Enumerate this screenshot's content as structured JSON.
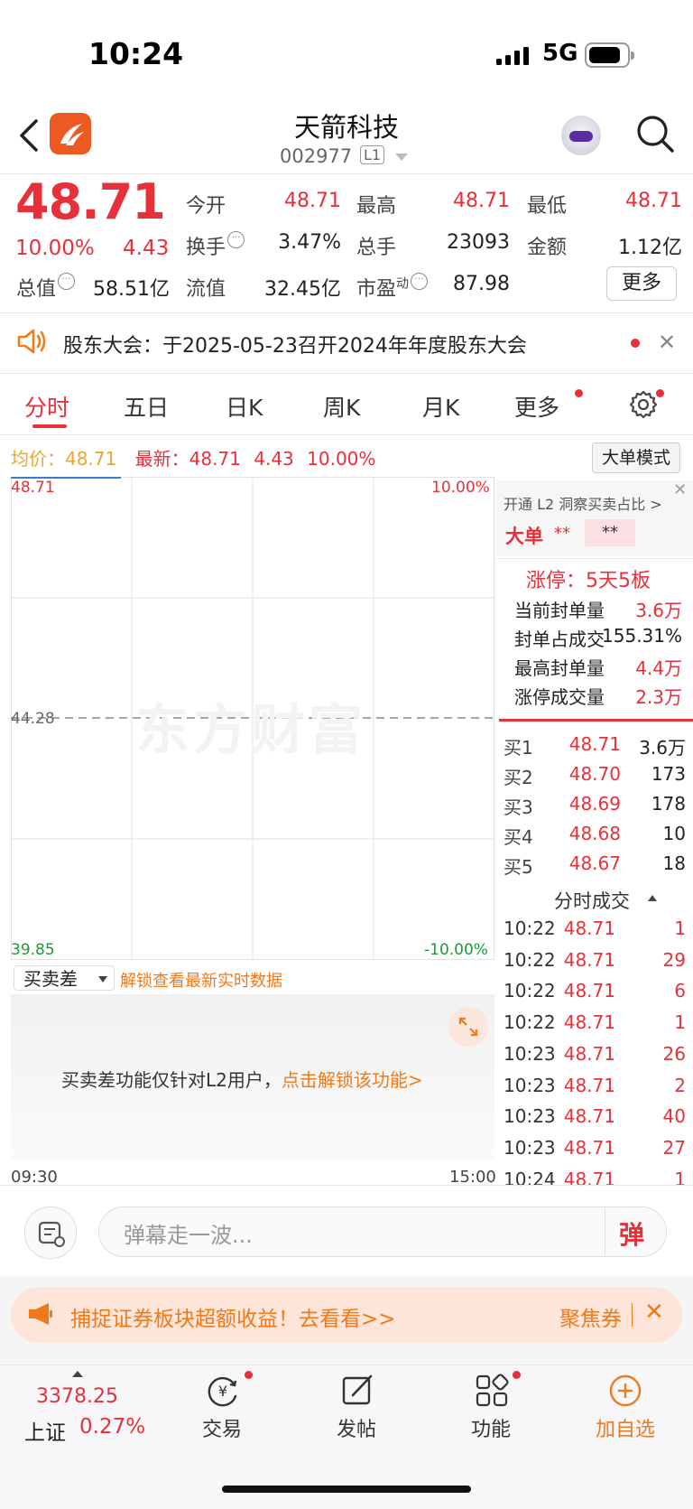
{
  "status_bar": {
    "time": "10:24",
    "network": "5G"
  },
  "header": {
    "title": "天箭科技",
    "code": "002977",
    "level": "L1"
  },
  "quote": {
    "price": "48.71",
    "change_pct": "10.00%",
    "change": "4.43",
    "open_label": "今开",
    "open": "48.71",
    "high_label": "最高",
    "high": "48.71",
    "low_label": "最低",
    "low": "48.71",
    "turnover_label": "换手",
    "turnover": "3.47%",
    "volume_label": "总手",
    "volume": "23093",
    "amount_label": "金额",
    "amount": "1.12亿",
    "mcap_label": "总值",
    "mcap": "58.51亿",
    "float_label": "流值",
    "float": "32.45亿",
    "pe_label": "市盈",
    "pe_sup": "动",
    "pe": "87.98",
    "more": "更多"
  },
  "notice": {
    "text": "股东大会：于2025-05-23召开2024年年度股东大会",
    "close": "✕"
  },
  "tabs": [
    "分时",
    "五日",
    "日K",
    "周K",
    "月K",
    "更多"
  ],
  "info_line": {
    "avg_label": "均价：",
    "avg": "48.71",
    "latest_label": "最新：",
    "latest": "48.71",
    "change": "4.43",
    "pct": "10.00%",
    "big_order_mode": "大单模式"
  },
  "chart": {
    "top_price": "48.71",
    "top_pct": "10.00%",
    "mid_price": "44.28",
    "bottom_price": "39.85",
    "bottom_pct": "-10.00%",
    "watermark": "东方财富",
    "start_time": "09:30",
    "end_time": "15:00"
  },
  "chart_data": {
    "type": "line",
    "x": [
      "09:30",
      "10:24"
    ],
    "series": [],
    "ylim": [
      39.85,
      48.71
    ],
    "reference": 44.28,
    "grid": true
  },
  "bsd": {
    "select": "买卖差",
    "unlock_text": "解锁查看最新实时数据",
    "message_prefix": "买卖差功能仅针对L2用户，",
    "message_link": "点击解锁该功能>"
  },
  "right_panel": {
    "l2_title": "开通 L2 洞察买卖占比 >",
    "big_order_label": "大单",
    "big_order_value1": "**",
    "big_order_value2": "**",
    "limit_status": "涨停：5天5板",
    "seal_rows": [
      {
        "label": "当前封单量",
        "value": "3.6万",
        "color": "red"
      },
      {
        "label": "封单占成交",
        "value": "155.31%",
        "color": "black"
      },
      {
        "label": "最高封单量",
        "value": "4.4万",
        "color": "red"
      },
      {
        "label": "涨停成交量",
        "value": "2.3万",
        "color": "red"
      }
    ],
    "buy_rows": [
      {
        "label": "买1",
        "price": "48.71",
        "vol": "3.6万"
      },
      {
        "label": "买2",
        "price": "48.70",
        "vol": "173"
      },
      {
        "label": "买3",
        "price": "48.69",
        "vol": "178"
      },
      {
        "label": "买4",
        "price": "48.68",
        "vol": "10"
      },
      {
        "label": "买5",
        "price": "48.67",
        "vol": "18"
      }
    ],
    "ticks_title": "分时成交",
    "ticks": [
      {
        "time": "10:22",
        "price": "48.71",
        "vol": "1"
      },
      {
        "time": "10:22",
        "price": "48.71",
        "vol": "29"
      },
      {
        "time": "10:22",
        "price": "48.71",
        "vol": "6"
      },
      {
        "time": "10:22",
        "price": "48.71",
        "vol": "1"
      },
      {
        "time": "10:23",
        "price": "48.71",
        "vol": "26"
      },
      {
        "time": "10:23",
        "price": "48.71",
        "vol": "2"
      },
      {
        "time": "10:23",
        "price": "48.71",
        "vol": "40"
      },
      {
        "time": "10:23",
        "price": "48.71",
        "vol": "27"
      },
      {
        "time": "10:24",
        "price": "48.71",
        "vol": "1"
      }
    ]
  },
  "danmu": {
    "placeholder": "弹幕走一波...",
    "button": "弹"
  },
  "banner": {
    "text": "捕捉证券板块超额收益！去看看>>",
    "right": "聚焦券",
    "close": "✕"
  },
  "bottom": {
    "index_value": "3378.25",
    "index_name": "上证",
    "index_pct": "0.27%",
    "nav": [
      "交易",
      "发帖",
      "功能",
      "加自选"
    ]
  },
  "colors": {
    "red": "#e8303a",
    "green": "#1a9e33",
    "orange": "#f07a1a"
  }
}
